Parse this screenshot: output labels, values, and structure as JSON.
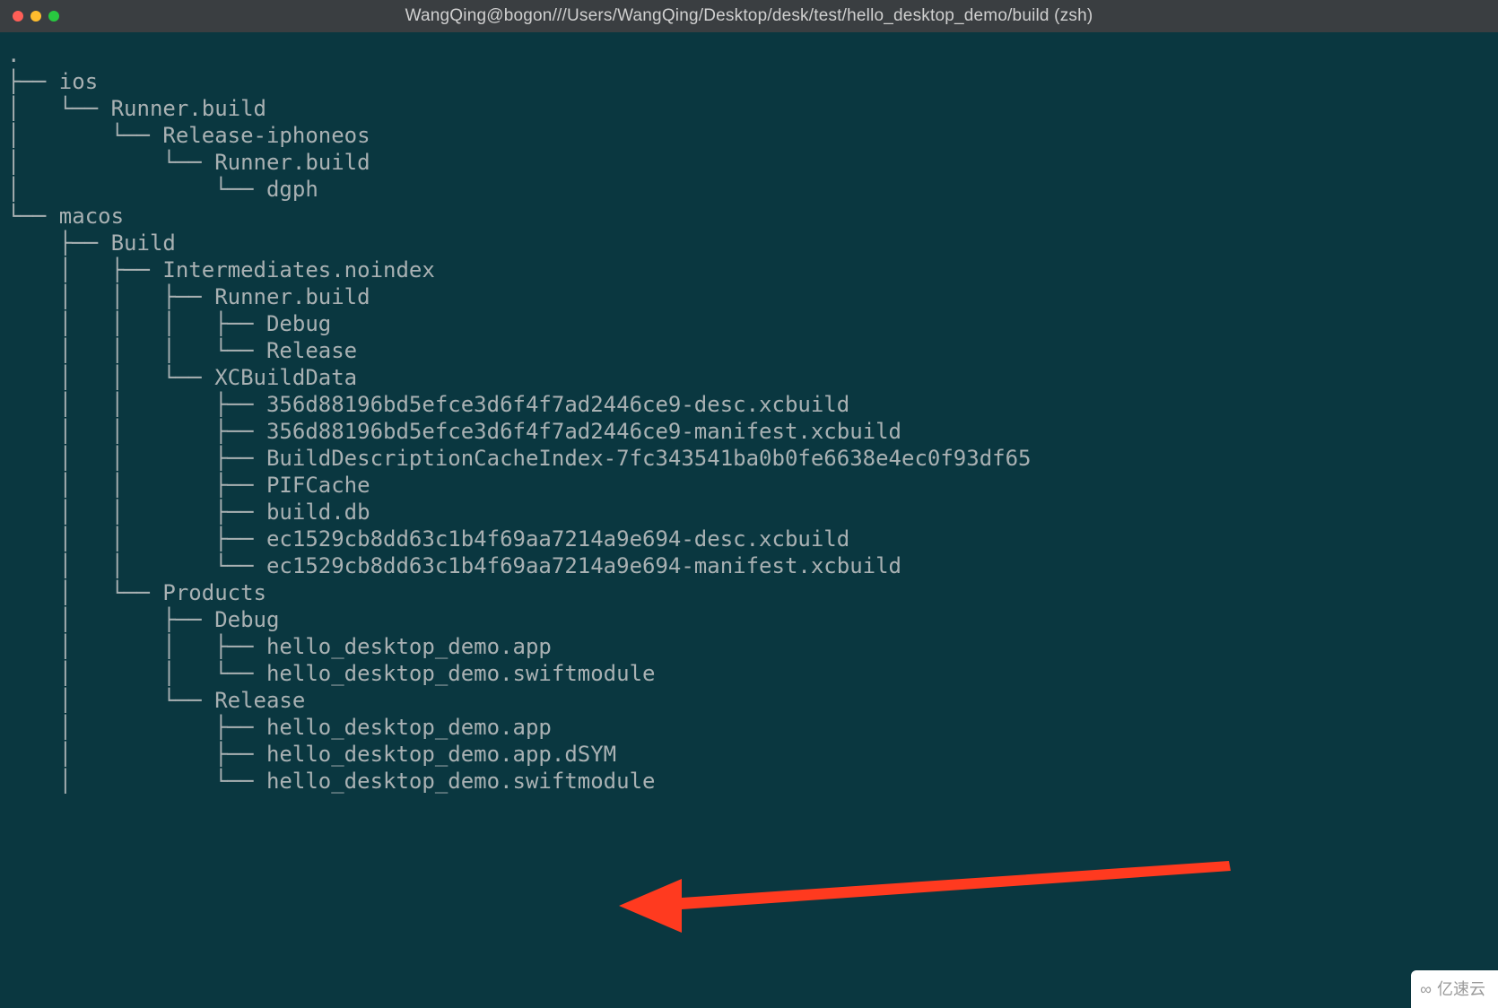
{
  "window": {
    "title": "WangQing@bogon///Users/WangQing/Desktop/desk/test/hello_desktop_demo/build (zsh)"
  },
  "tree": {
    "lines": [
      ".",
      "├── ios",
      "│   └── Runner.build",
      "│       └── Release-iphoneos",
      "│           └── Runner.build",
      "│               └── dgph",
      "└── macos",
      "    ├── Build",
      "    │   ├── Intermediates.noindex",
      "    │   │   ├── Runner.build",
      "    │   │   │   ├── Debug",
      "    │   │   │   └── Release",
      "    │   │   └── XCBuildData",
      "    │   │       ├── 356d88196bd5efce3d6f4f7ad2446ce9-desc.xcbuild",
      "    │   │       ├── 356d88196bd5efce3d6f4f7ad2446ce9-manifest.xcbuild",
      "    │   │       ├── BuildDescriptionCacheIndex-7fc343541ba0b0fe6638e4ec0f93df65",
      "    │   │       ├── PIFCache",
      "    │   │       ├── build.db",
      "    │   │       ├── ec1529cb8dd63c1b4f69aa7214a9e694-desc.xcbuild",
      "    │   │       └── ec1529cb8dd63c1b4f69aa7214a9e694-manifest.xcbuild",
      "    │   └── Products",
      "    │       ├── Debug",
      "    │       │   ├── hello_desktop_demo.app",
      "    │       │   └── hello_desktop_demo.swiftmodule",
      "    │       └── Release",
      "    │           ├── hello_desktop_demo.app",
      "    │           ├── hello_desktop_demo.app.dSYM",
      "    │           └── hello_desktop_demo.swiftmodule"
    ]
  },
  "watermark": {
    "text": "亿速云"
  },
  "annotation": {
    "arrow_target": "macos/Build/Products/Release/hello_desktop_demo.app",
    "arrow_color": "#ff3a1f"
  }
}
